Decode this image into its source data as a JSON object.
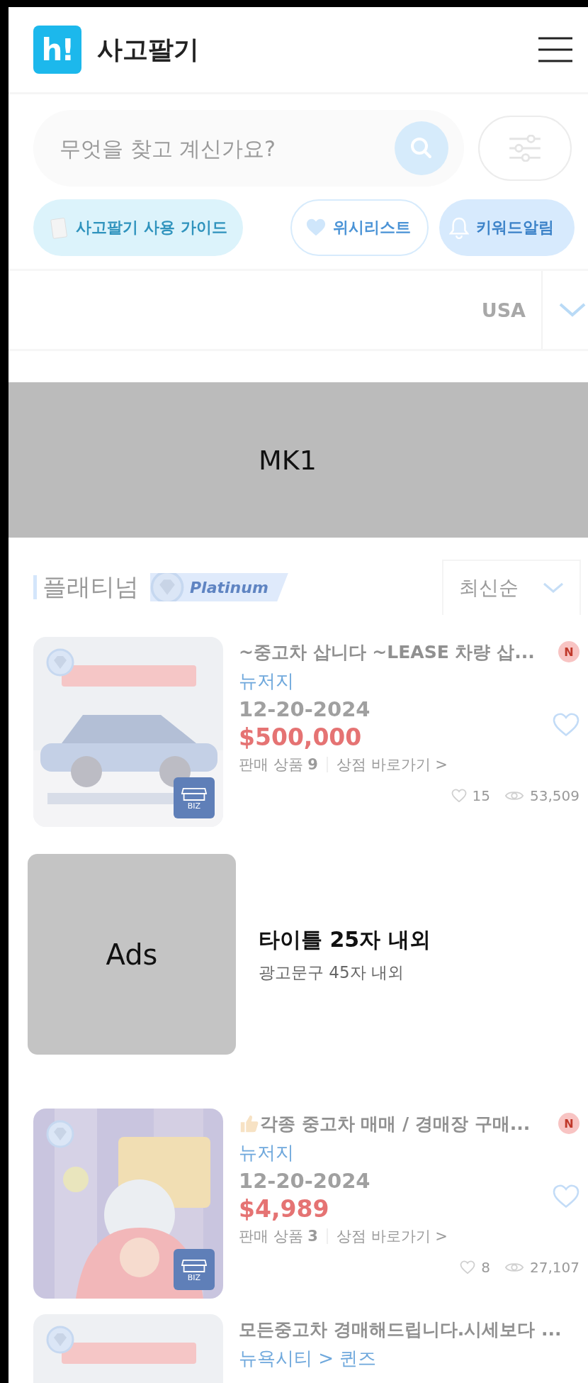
{
  "header": {
    "logo_text": "h!",
    "title": "사고팔기"
  },
  "search": {
    "placeholder": "무엇을 찾고 계신가요?"
  },
  "quick_buttons": [
    {
      "kind": "guide",
      "label": "사고팔기 사용 가이드"
    },
    {
      "kind": "wish",
      "label": "위시리스트"
    },
    {
      "kind": "alert",
      "label": "키워드알림"
    }
  ],
  "region": {
    "value": "USA"
  },
  "banner": {
    "label": "MK1"
  },
  "section": {
    "title": "플래티넘",
    "badge": "Platinum",
    "sort": "최신순"
  },
  "listings": [
    {
      "kind": "listing",
      "title": "~중고차 삽니다 ~LEASE 차량 삽...",
      "new_badge": "N",
      "location": "뉴저지",
      "date": "12-20-2024",
      "price": "$500,000",
      "liked": false,
      "count_label": "판매 상품",
      "count": "9",
      "store_link": "상점 바로가기 >",
      "biz": "BIZ",
      "likes": "15",
      "views": "53,509",
      "thumb": false
    },
    {
      "kind": "ad",
      "thumb_label": "Ads",
      "title": "타이틀 25자 내외",
      "text": "광고문구 45자 내외"
    },
    {
      "kind": "listing",
      "title": "각종 중고차 매매 / 경매장 구매...",
      "new_badge": "N",
      "location": "뉴저지",
      "date": "12-20-2024",
      "price": "$4,989",
      "liked": false,
      "count_label": "판매 상품",
      "count": "3",
      "store_link": "상점 바로가기 >",
      "biz": "BIZ",
      "likes": "8",
      "views": "27,107",
      "thumb": true
    },
    {
      "kind": "listing",
      "title": "모든중고차 경매해드립니다.시세보다 ...",
      "location": "뉴욕시티 > 퀸즈",
      "thumb": false
    }
  ]
}
